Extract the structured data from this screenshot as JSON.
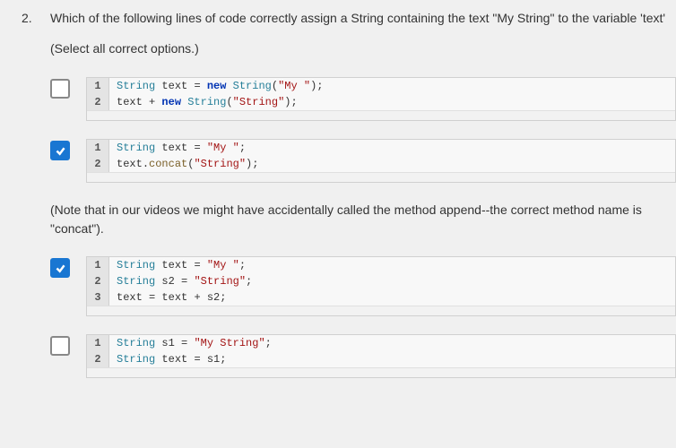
{
  "question": {
    "number": "2.",
    "text": "Which of the following lines of code correctly assign a String containing the text \"My String\" to the variable 'text'",
    "instruction": "(Select all correct options.)"
  },
  "note": "(Note that in our videos we might have accidentally called the method append--the correct method name is \"concat\").",
  "options": [
    {
      "checked": false,
      "lines": [
        {
          "n": "1",
          "tokens": [
            [
              "cls",
              "String"
            ],
            [
              "",
              ""
            ],
            [
              "",
              "text"
            ],
            [
              "",
              ""
            ],
            [
              "op",
              "="
            ],
            [
              "",
              ""
            ],
            [
              "kw",
              "new"
            ],
            [
              "",
              ""
            ],
            [
              "cls",
              "String"
            ],
            [
              "op",
              "("
            ],
            [
              "str",
              "\"My \""
            ],
            [
              "op",
              ");"
            ]
          ]
        },
        {
          "n": "2",
          "tokens": [
            [
              "",
              "text"
            ],
            [
              "",
              ""
            ],
            [
              "op",
              "+"
            ],
            [
              "",
              ""
            ],
            [
              "kw",
              "new"
            ],
            [
              "",
              ""
            ],
            [
              "cls",
              "String"
            ],
            [
              "op",
              "("
            ],
            [
              "str",
              "\"String\""
            ],
            [
              "op",
              ");"
            ]
          ]
        }
      ]
    },
    {
      "checked": true,
      "lines": [
        {
          "n": "1",
          "tokens": [
            [
              "cls",
              "String"
            ],
            [
              "",
              ""
            ],
            [
              "",
              "text"
            ],
            [
              "",
              ""
            ],
            [
              "op",
              "="
            ],
            [
              "",
              ""
            ],
            [
              "str",
              "\"My \""
            ],
            [
              "op",
              ";"
            ]
          ]
        },
        {
          "n": "2",
          "tokens": [
            [
              "",
              "text"
            ],
            [
              "op",
              "."
            ],
            [
              "fn",
              "concat"
            ],
            [
              "op",
              "("
            ],
            [
              "str",
              "\"String\""
            ],
            [
              "op",
              ");"
            ]
          ]
        }
      ]
    },
    {
      "checked": true,
      "lines": [
        {
          "n": "1",
          "tokens": [
            [
              "cls",
              "String"
            ],
            [
              "",
              ""
            ],
            [
              "",
              "text"
            ],
            [
              "",
              ""
            ],
            [
              "op",
              "="
            ],
            [
              "",
              ""
            ],
            [
              "str",
              "\"My \""
            ],
            [
              "op",
              ";"
            ]
          ]
        },
        {
          "n": "2",
          "tokens": [
            [
              "cls",
              "String"
            ],
            [
              "",
              ""
            ],
            [
              "",
              "s2"
            ],
            [
              "",
              ""
            ],
            [
              "op",
              "="
            ],
            [
              "",
              ""
            ],
            [
              "str",
              "\"String\""
            ],
            [
              "op",
              ";"
            ]
          ]
        },
        {
          "n": "3",
          "tokens": [
            [
              "",
              "text"
            ],
            [
              "",
              ""
            ],
            [
              "op",
              "="
            ],
            [
              "",
              ""
            ],
            [
              "",
              "text"
            ],
            [
              "",
              ""
            ],
            [
              "op",
              "+"
            ],
            [
              "",
              ""
            ],
            [
              "",
              "s2"
            ],
            [
              "op",
              ";"
            ]
          ]
        }
      ]
    },
    {
      "checked": false,
      "lines": [
        {
          "n": "1",
          "tokens": [
            [
              "cls",
              "String"
            ],
            [
              "",
              ""
            ],
            [
              "",
              "s1"
            ],
            [
              "",
              ""
            ],
            [
              "op",
              "="
            ],
            [
              "",
              ""
            ],
            [
              "str",
              "\"My String\""
            ],
            [
              "op",
              ";"
            ]
          ]
        },
        {
          "n": "2",
          "tokens": [
            [
              "cls",
              "String"
            ],
            [
              "",
              ""
            ],
            [
              "",
              "text"
            ],
            [
              "",
              ""
            ],
            [
              "op",
              "="
            ],
            [
              "",
              ""
            ],
            [
              "",
              "s1"
            ],
            [
              "op",
              ";"
            ]
          ]
        }
      ]
    }
  ]
}
